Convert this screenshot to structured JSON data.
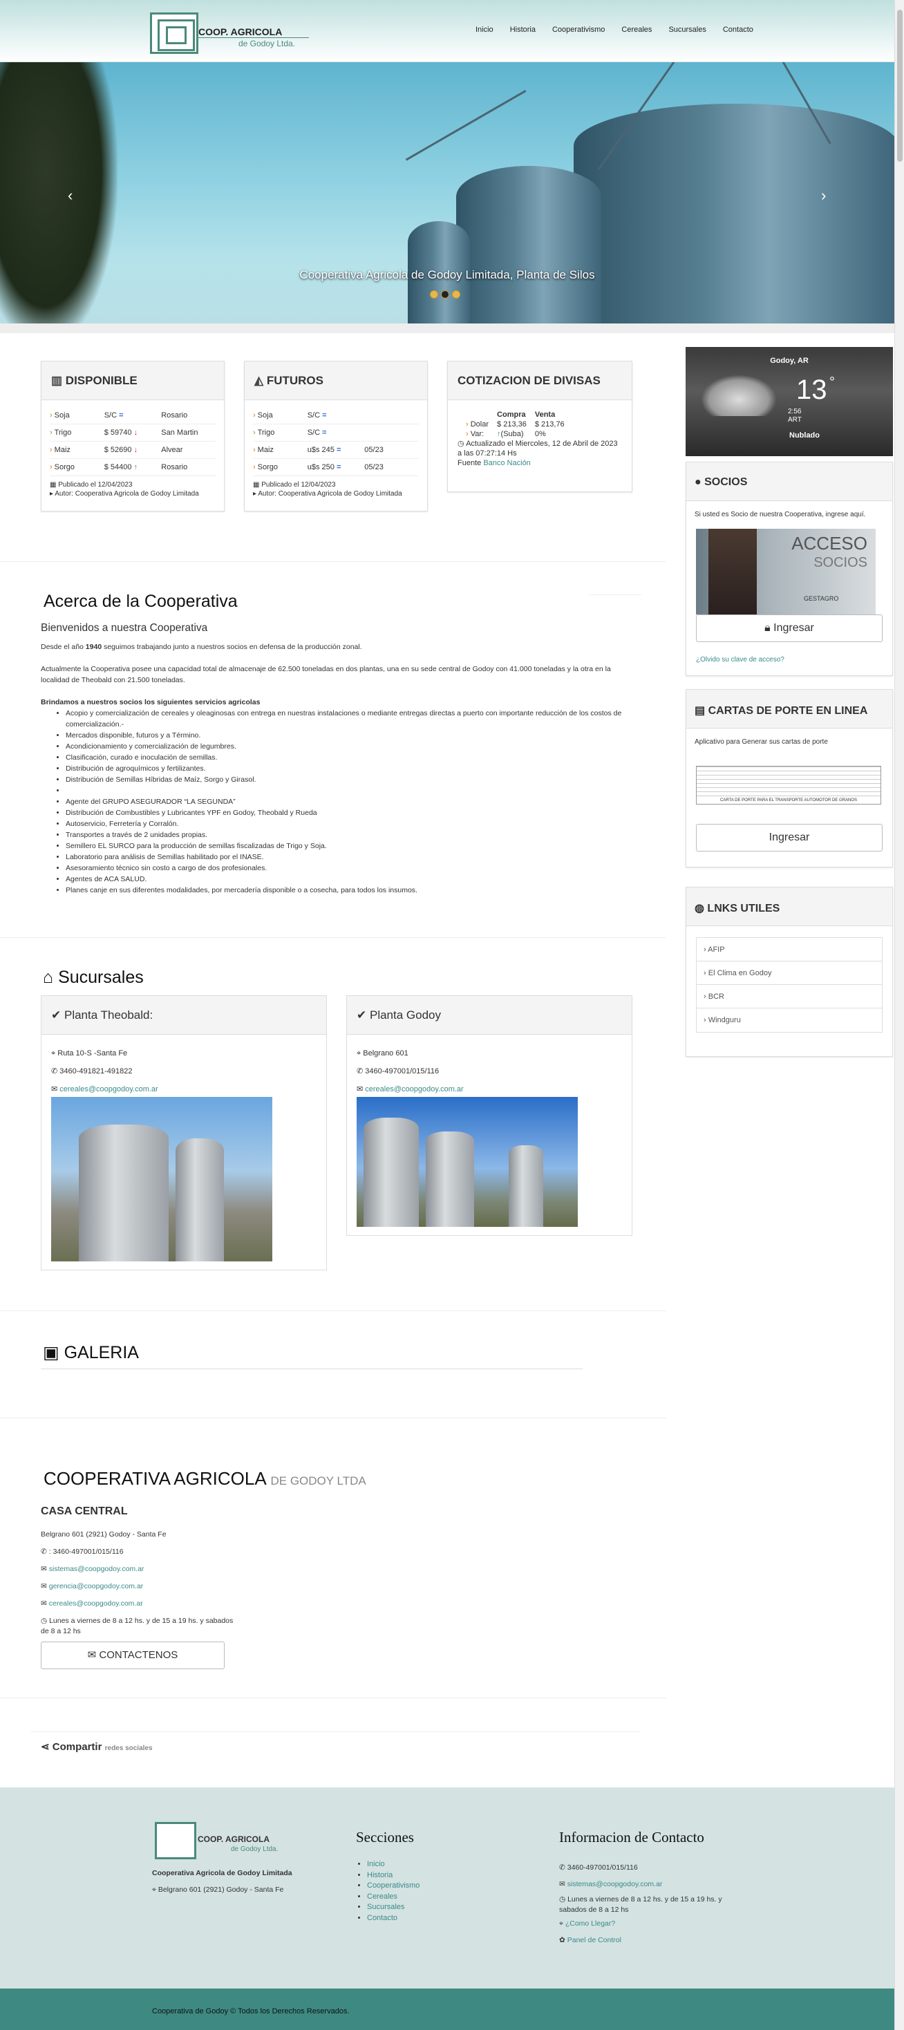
{
  "brand": {
    "line1": "COOP. AGRICOLA",
    "line2": "de Godoy Ltda."
  },
  "nav": [
    "Inicio",
    "Historia",
    "Cooperativismo",
    "Cereales",
    "Sucursales",
    "Contacto"
  ],
  "hero": {
    "caption": "Cooperativa Agricola de Godoy Limitada, Planta de Silos",
    "prev": "‹",
    "next": "›"
  },
  "disponible": {
    "title": "DISPONIBLE",
    "rows": [
      {
        "grain": "Soja",
        "price": "S/C",
        "trend": "eq",
        "place": "Rosario"
      },
      {
        "grain": "Trigo",
        "price": "$ 59740",
        "trend": "dn",
        "place": "San Martin"
      },
      {
        "grain": "Maiz",
        "price": "$ 52690",
        "trend": "dn",
        "place": "Alvear"
      },
      {
        "grain": "Sorgo",
        "price": "$ 54400",
        "trend": "up",
        "place": "Rosario"
      }
    ],
    "published": "Publicado el 12/04/2023",
    "author": "Autor: Cooperativa Agricola de Godoy Limitada"
  },
  "futuros": {
    "title": "FUTUROS",
    "rows": [
      {
        "grain": "Soja",
        "price": "S/C",
        "trend": "eq",
        "place": ""
      },
      {
        "grain": "Trigo",
        "price": "S/C",
        "trend": "eq",
        "place": ""
      },
      {
        "grain": "Maiz",
        "price": "u$s 245",
        "trend": "eq",
        "place": "05/23"
      },
      {
        "grain": "Sorgo",
        "price": "u$s 250",
        "trend": "eq",
        "place": "05/23"
      }
    ],
    "published": "Publicado el 12/04/2023",
    "author": "Autor: Cooperativa Agricola de Godoy Limitada"
  },
  "divisas": {
    "title": "COTIZACION DE DIVISAS",
    "h_compra": "Compra",
    "h_venta": "Venta",
    "dolar_label": "Dolar",
    "dolar_compra": "$ 213,36",
    "dolar_venta": "$ 213,76",
    "var_label": "Var:",
    "var_compra": "(Suba)",
    "var_venta": "0%",
    "updated": "Actualizado el Miercoles, 12 de Abril de 2023 a las 07:27:14 Hs",
    "source_label": "Fuente",
    "source": "Banco Nación"
  },
  "weather": {
    "location": "Godoy, AR",
    "temp": "13",
    "deg": "°",
    "time": "2:56",
    "tz": "ART",
    "condition": "Nublado"
  },
  "socios": {
    "title": "SOCIOS",
    "text": "Si usted es Socio de nuestra Cooperativa, ingrese aquí.",
    "banner1": "ACCESO",
    "banner2": "SOCIOS",
    "banner_small": "GESTAGRO",
    "button": "Ingresar",
    "forgot": "¿Olvido su clave de acceso?"
  },
  "cartas": {
    "title": "CARTAS DE PORTE EN LINEA",
    "text": "Aplicativo para Generar sus cartas de porte",
    "doc_caption": "CARTA DE PORTE PARA EL TRANSPORTE AUTOMOTOR DE GRANOS",
    "button": "Ingresar"
  },
  "links": {
    "title": "LNKS UTILES",
    "items": [
      "AFIP",
      "El Clima en Godoy",
      "BCR",
      "Windguru"
    ]
  },
  "about": {
    "title": "Acerca de la Cooperativa",
    "subtitle": "Bienvenidos a nuestra Cooperativa",
    "p1a": "Desde el año ",
    "p1b": "1940",
    "p1c": " seguimos trabajando junto a nuestros socios en defensa de la producción zonal.",
    "p2": "Actualmente la Cooperativa posee una capacidad total de almacenaje de 62.500 toneladas en dos plantas, una en su sede central de Godoy con 41.000 toneladas y la otra en la localidad de Theobald con 21.500 toneladas.",
    "services_title": "Brindamos a nuestros socios los siguientes servicios agricolas",
    "services": [
      "Acopio y comercialización de cereales y oleaginosas con  entrega en nuestras instalaciones o mediante entregas directas a puerto con  importante   reducción de los costos de  comercialización.-",
      "Mercados disponible, futuros y a Término.",
      "Acondicionamiento y comercialización de legumbres.",
      "Clasificación, curado e inoculación de semillas.",
      "Distribución de agroquímicos y fertilizantes.",
      "Distribución de Semillas Híbridas de Maíz, Sorgo y Girasol.",
      "",
      "Agente del GRUPO ASEGURADOR “LA SEGUNDA”",
      "Distribución de Combustibles y Lubricantes YPF  en Godoy, Theobald y Rueda",
      "Autoservicio, Ferretería y Corralón.",
      "Transportes a través de 2 unidades propias.",
      "Semillero EL SURCO para la producción de semillas fiscalizadas de Trigo y Soja.",
      "Laboratorio para análisis de Semillas habilitado por el INASE.",
      "Asesoramiento técnico sin costo a cargo de dos profesionales.",
      "Agentes de ACA SALUD.",
      "Planes canje en sus diferentes modalidades, por mercadería disponible o a cosecha, para todos los insumos."
    ]
  },
  "sucursales": {
    "title": "Sucursales",
    "theobald": {
      "name": "Planta Theobald:",
      "address": "Ruta 10-S -Santa Fe",
      "phone": "3460-491821-491822",
      "email": "cereales@coopgodoy.com.ar"
    },
    "godoy": {
      "name": "Planta Godoy",
      "address": "Belgrano 601",
      "phone": "3460-497001/015/116",
      "email": "cereales@coopgodoy.com.ar"
    }
  },
  "galeria": {
    "title": "GALERIA"
  },
  "contacto": {
    "title": "COOPERATIVA AGRICOLA",
    "title_small": "DE GODOY LTDA",
    "casa": "CASA CENTRAL",
    "address": "Belgrano 601 (2921) Godoy - Santa Fe",
    "phone": ": 3460-497001/015/116",
    "email1": "sistemas@coopgodoy.com.ar",
    "email2": "gerencia@coopgodoy.com.ar",
    "email3": "cereales@coopgodoy.com.ar",
    "hours": "Lunes a viernes de 8 a 12 hs. y de 15 a 19 hs. y sabados de 8 a 12 hs",
    "button": "CONTACTENOS"
  },
  "share": {
    "label": "Compartir",
    "sub": "redes sociales"
  },
  "footer": {
    "company": "Cooperativa Agricola de Godoy Limitada",
    "address": "Belgrano 601 (2921) Godoy - Santa Fe",
    "secciones_title": "Secciones",
    "secciones": [
      "Inicio",
      "Historia",
      "Cooperativismo",
      "Cereales",
      "Sucursales",
      "Contacto"
    ],
    "info_title": "Informacion de Contacto",
    "phone": "3460-497001/015/116",
    "email": "sistemas@coopgodoy.com.ar",
    "hours": "Lunes a viernes de 8 a 12 hs. y de 15 a 19 hs. y sabados de 8 a 12 hs",
    "llegar": "¿Como Llegar?",
    "panel": "Panel de Control",
    "copyright": "Cooperativa de Godoy © Todos los Derechos Reservados."
  },
  "colors": {
    "accent": "#3a8a8a",
    "footer_bg": "#d4e2e2",
    "footer_bar": "#3e8a82"
  }
}
